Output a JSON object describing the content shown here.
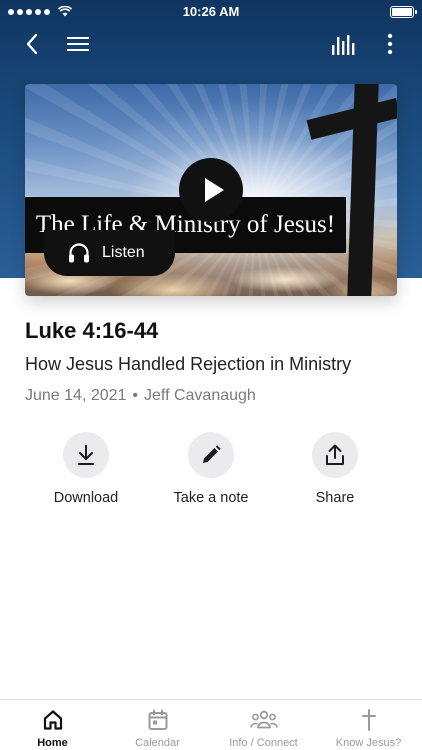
{
  "status_bar": {
    "time": "10:26 AM"
  },
  "media": {
    "banner_text": "The Life & Ministry of Jesus!",
    "listen_label": "Listen"
  },
  "sermon": {
    "title": "Luke 4:16-44",
    "subtitle": "How Jesus Handled Rejection in Ministry",
    "date": "June 14, 2021",
    "separator": "•",
    "speaker": "Jeff Cavanaugh"
  },
  "actions": {
    "download_label": "Download",
    "note_label": "Take a note",
    "share_label": "Share"
  },
  "tabbar": {
    "home_label": "Home",
    "calendar_label": "Calendar",
    "info_label": "Info / Connect",
    "know_label": "Know Jesus?"
  },
  "icons": {
    "back": "chevron-left-icon",
    "menu": "hamburger-icon",
    "bars": "audio-bars-icon",
    "more": "vertical-dots-icon",
    "play": "play-icon",
    "headphones": "headphones-icon",
    "download": "download-icon",
    "pencil": "pencil-icon",
    "share": "share-icon",
    "home": "home-icon",
    "calendar": "calendar-icon",
    "people": "people-icon",
    "cross": "cross-icon"
  },
  "colors": {
    "header_blue": "#1b4b7e",
    "active_tab": "#111111",
    "inactive_tab": "#9a9a9a",
    "action_circle": "#ebebed"
  }
}
